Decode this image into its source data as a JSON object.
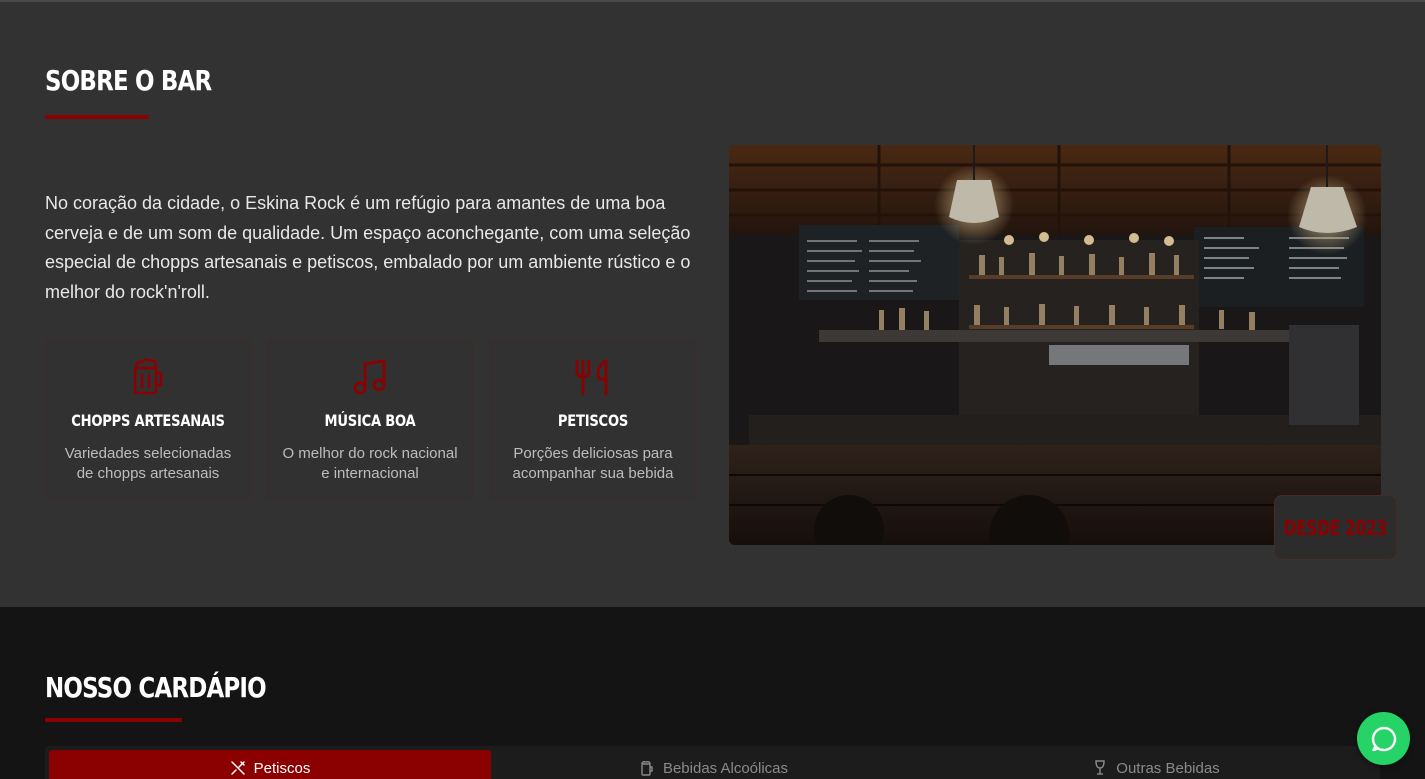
{
  "about": {
    "title": "SOBRE O BAR",
    "text": "No coração da cidade, o Eskina Rock é um refúgio para amantes de uma boa cerveja e de um som de qualidade. Um espaço aconchegante, com uma seleção especial de chopps artesanais e petiscos, embalado por um ambiente rústico e o melhor do rock'n'roll.",
    "features": [
      {
        "icon": "beer-mug-icon",
        "name": "CHOPPS ARTESANAIS",
        "desc": "Variedades selecionadas de chopps artesanais"
      },
      {
        "icon": "music-note-icon",
        "name": "MÚSICA BOA",
        "desc": "O melhor do rock nacional e internacional"
      },
      {
        "icon": "utensils-icon",
        "name": "PETISCOS",
        "desc": "Porções deliciosas para acompanhar sua bebida"
      }
    ],
    "badge": "DESDE 2023"
  },
  "menu": {
    "title": "NOSSO CARDÁPIO",
    "tabs": [
      {
        "label": "Petiscos",
        "icon": "utensils-crossed-icon",
        "active": true
      },
      {
        "label": "Bebidas Alcoólicas",
        "icon": "beer-icon",
        "active": false
      },
      {
        "label": "Outras Bebidas",
        "icon": "glass-icon",
        "active": false
      }
    ]
  },
  "colors": {
    "accent": "#8b0000",
    "section_bg": "#323232",
    "dark_bg": "#141414",
    "whatsapp": "#25d366"
  }
}
